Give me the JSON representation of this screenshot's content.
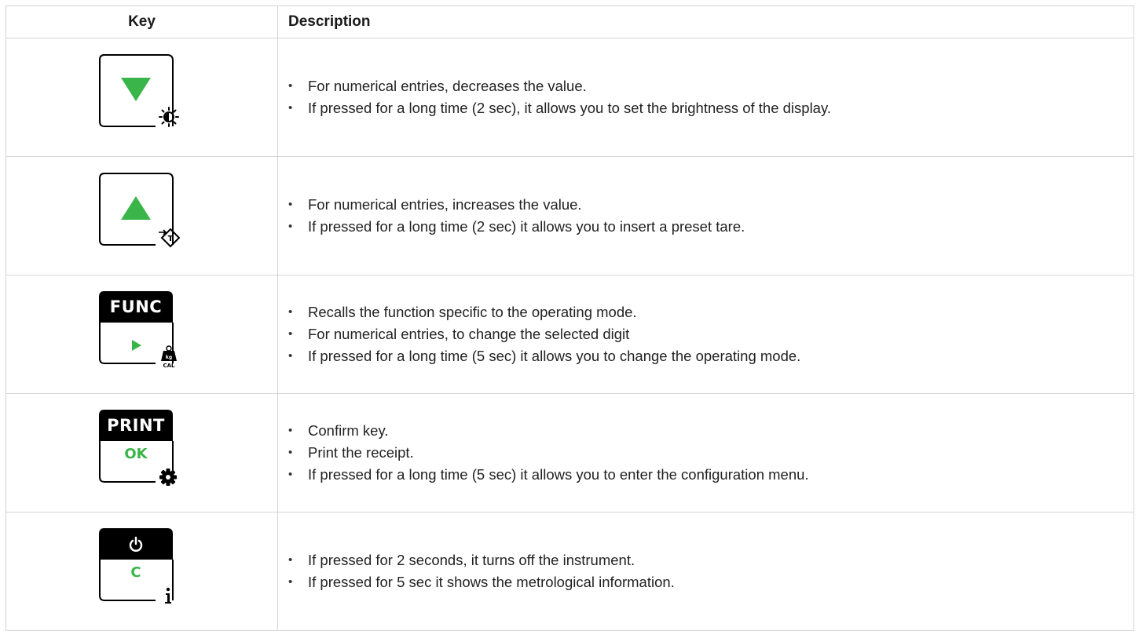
{
  "table": {
    "header": {
      "key": "Key",
      "description": "Description"
    },
    "rows": [
      {
        "key_icon": "down-arrow-key",
        "corner_icon": "brightness-icon",
        "lines": [
          "For numerical entries, decreases the value.",
          "If pressed for a long time (2 sec), it allows you to set the brightness of the display."
        ]
      },
      {
        "key_icon": "up-arrow-key",
        "corner_icon": "preset-tare-icon",
        "lines": [
          "For numerical entries, increases the value.",
          "If pressed for a long time (2 sec) it allows you to insert a preset tare."
        ]
      },
      {
        "key_icon": "func-key",
        "key_top_label": "FUNC",
        "corner_icon": "kg-cal-weight-icon",
        "corner_top": "kg",
        "corner_bottom": "CAL",
        "lines": [
          "Recalls the function specific to the operating mode.",
          "For numerical entries, to change the selected digit",
          "If pressed for a long time (5 sec) it allows you to change the operating mode."
        ]
      },
      {
        "key_icon": "print-key",
        "key_top_label": "PRINT",
        "key_green_label": "OK",
        "corner_icon": "gear-icon",
        "lines": [
          "Confirm key.",
          "Print the receipt.",
          "If pressed for a long time (5 sec) it allows you to enter the configuration menu."
        ]
      },
      {
        "key_icon": "power-key",
        "key_green_label": "C",
        "corner_icon": "info-icon",
        "lines": [
          "If pressed for 2 seconds, it turns off the instrument.",
          "If pressed for 5 sec it shows the metrological information."
        ]
      }
    ]
  },
  "colors": {
    "accent_green": "#3ab54a",
    "key_black": "#000000",
    "border": "#d4d4d4"
  }
}
